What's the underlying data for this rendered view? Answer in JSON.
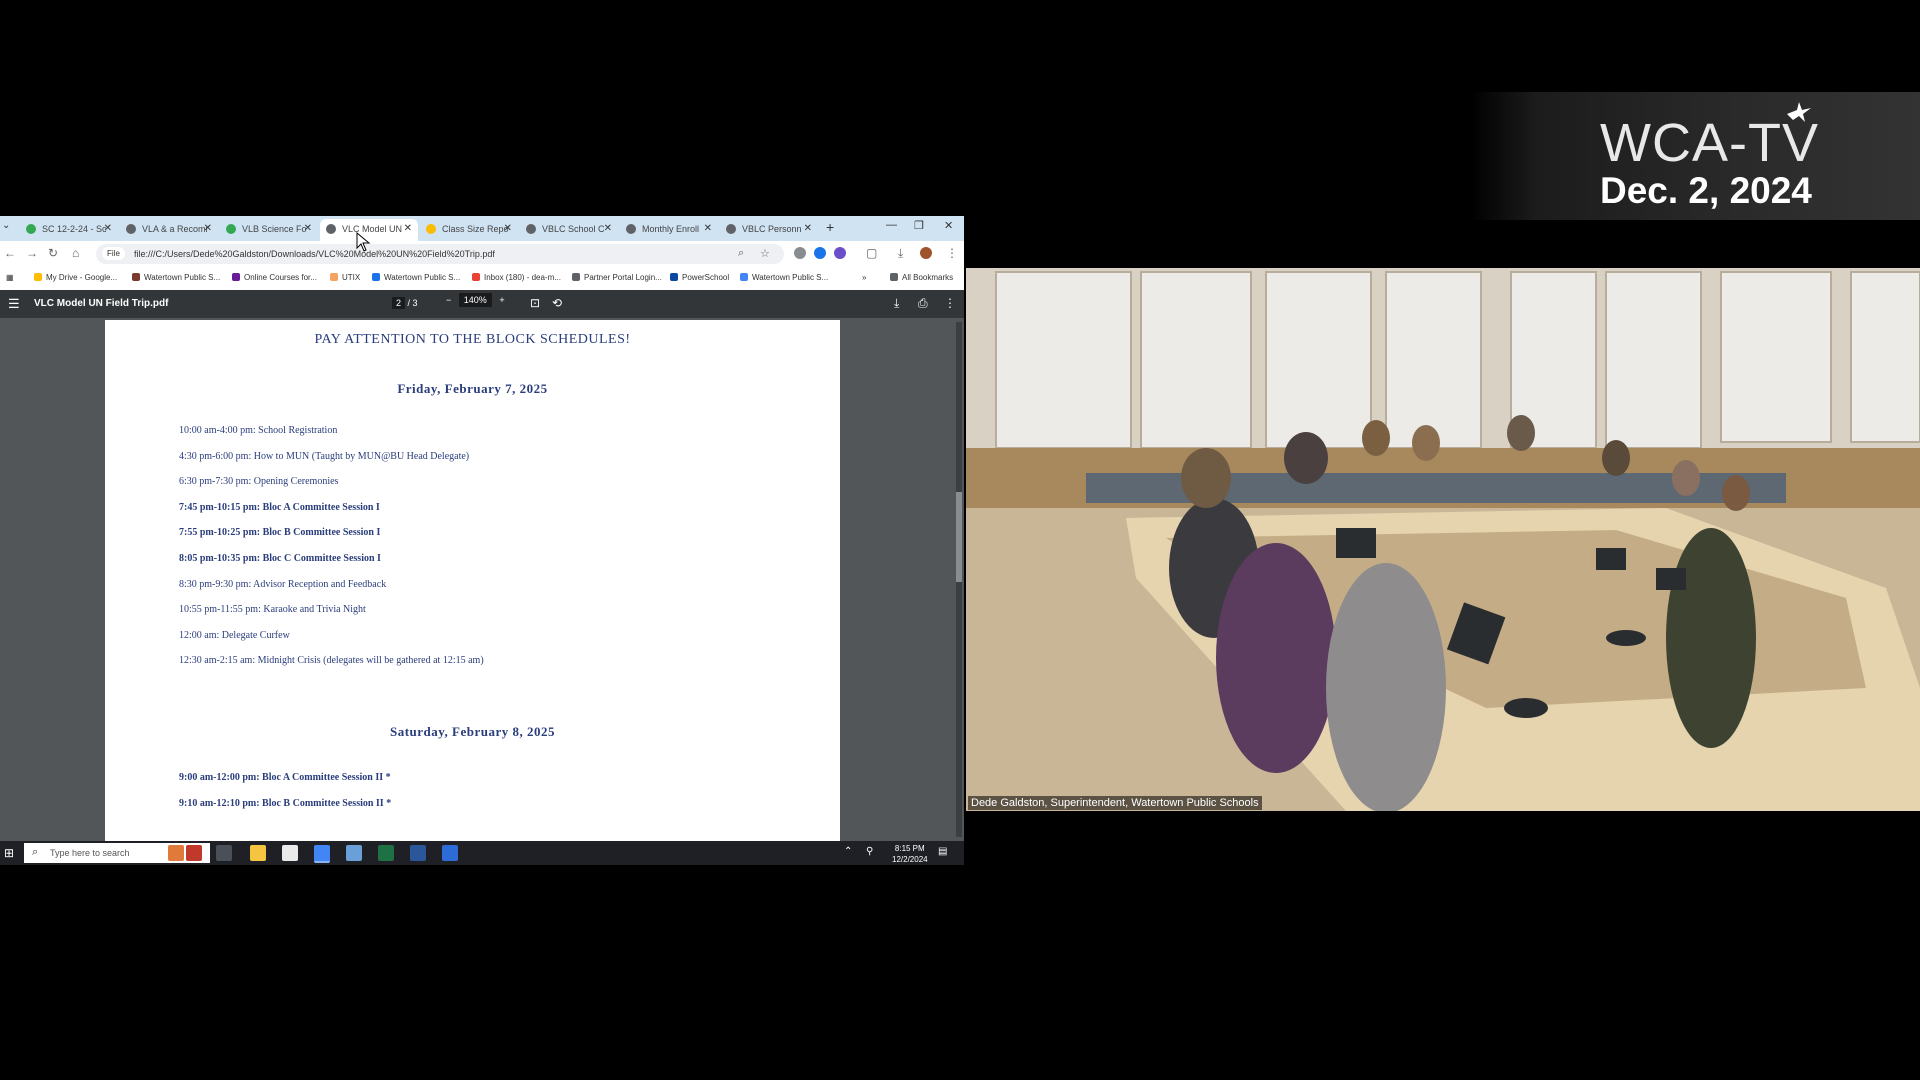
{
  "brand": {
    "logo": "WCA-TV",
    "date": "Dec. 2, 2024"
  },
  "browser": {
    "tabs": [
      {
        "label": "SC 12-2-24 - Sc",
        "color": "#34a853"
      },
      {
        "label": "VLA & a Recomr",
        "color": "#5f6368"
      },
      {
        "label": "VLB Science Fo",
        "color": "#34a853"
      },
      {
        "label": "VLC Model UN",
        "color": "#5f6368"
      },
      {
        "label": "Class Size Repo",
        "color": "#fbbc04"
      },
      {
        "label": "VBLC School C",
        "color": "#5f6368"
      },
      {
        "label": "Monthly Enroll",
        "color": "#5f6368"
      },
      {
        "label": "VBLC Personn",
        "color": "#5f6368"
      }
    ],
    "address": {
      "badge": "File",
      "url": "file:///C:/Users/Dede%20Galdston/Downloads/VLC%20Model%20UN%20Field%20Trip.pdf"
    },
    "bookmarks": [
      {
        "label": "My Drive - Google...",
        "color": "#fbbc04"
      },
      {
        "label": "Watertown Public S...",
        "color": "#7a3b2e"
      },
      {
        "label": "Online Courses for...",
        "color": "#6a1b9a"
      },
      {
        "label": "UTIX",
        "color": "#f4a460"
      },
      {
        "label": "Watertown Public S...",
        "color": "#1a73e8"
      },
      {
        "label": "Inbox (180) - dea-m...",
        "color": "#ea4335"
      },
      {
        "label": "Partner Portal Login...",
        "color": "#5f6368"
      },
      {
        "label": "PowerSchool",
        "color": "#0d47a1"
      },
      {
        "label": "Watertown Public S...",
        "color": "#4285f4"
      }
    ],
    "all_bookmarks": "All Bookmarks"
  },
  "pdf": {
    "title": "VLC Model UN Field Trip.pdf",
    "page_current": "2",
    "page_total": "3",
    "zoom": "140%"
  },
  "document": {
    "heading": "PAY ATTENTION TO THE BLOCK SCHEDULES!",
    "day1": "Friday, February 7, 2025",
    "day1_events": [
      {
        "text": "10:00 am-4:00 pm: School Registration",
        "bold": false
      },
      {
        "text": "4:30 pm-6:00 pm: How to MUN (Taught by MUN@BU Head Delegate)",
        "bold": false
      },
      {
        "text": "6:30 pm-7:30 pm: Opening Ceremonies",
        "bold": false
      },
      {
        "text": "7:45 pm-10:15 pm: Bloc A Committee Session I",
        "bold": true
      },
      {
        "text": "7:55 pm-10:25 pm: Bloc B Committee Session I",
        "bold": true
      },
      {
        "text": "8:05 pm-10:35 pm: Bloc C Committee Session I",
        "bold": true
      },
      {
        "text": "8:30 pm-9:30 pm: Advisor Reception and Feedback",
        "bold": false
      },
      {
        "text": "10:55 pm-11:55 pm: Karaoke and Trivia Night",
        "bold": false
      },
      {
        "text": "12:00 am: Delegate Curfew",
        "bold": false
      },
      {
        "text": "12:30 am-2:15 am: Midnight Crisis (delegates will be gathered at 12:15 am)",
        "bold": false
      }
    ],
    "day2": "Saturday, February 8, 2025",
    "day2_events": [
      {
        "text": "9:00 am-12:00 pm: Bloc A Committee Session II *",
        "bold": true
      },
      {
        "text": "9:10 am-12:10 pm: Bloc B Committee Session II *",
        "bold": true
      }
    ]
  },
  "taskbar": {
    "search_placeholder": "Type here to search",
    "time": "8:15 PM",
    "date": "12/2/2024"
  },
  "camera": {
    "caption": "Dede Galdston, Superintendent, Watertown Public Schools"
  }
}
